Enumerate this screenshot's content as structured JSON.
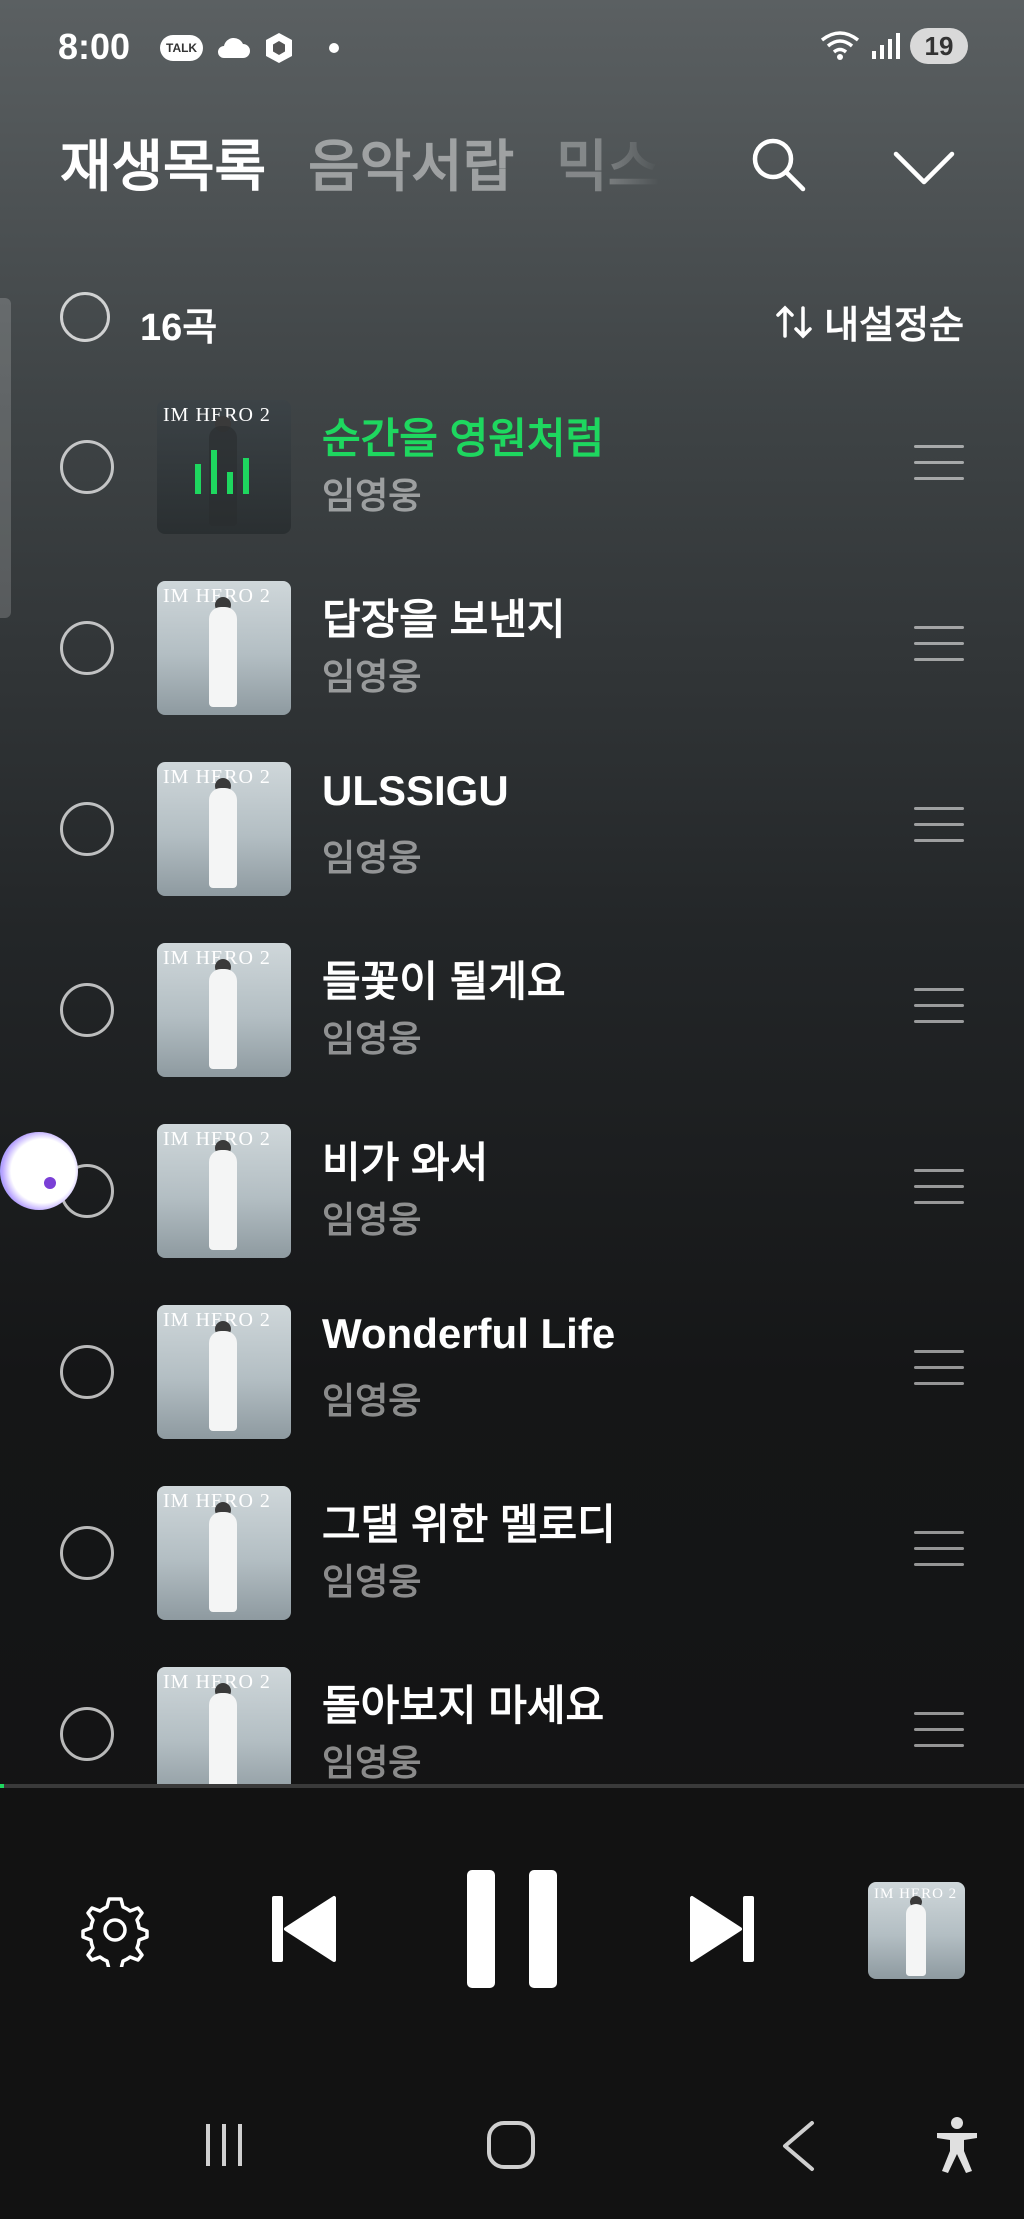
{
  "status_bar": {
    "time": "8:00",
    "talk_badge": "TALK",
    "battery": "19"
  },
  "header": {
    "tabs": [
      {
        "label": "재생목록",
        "active": true
      },
      {
        "label": "음악서랍",
        "active": false
      },
      {
        "label": "믹스",
        "active": false
      }
    ]
  },
  "list_header": {
    "count": "16곡",
    "sort_label": "내설정순"
  },
  "album_label": "IM HERO 2",
  "songs": [
    {
      "title": "순간을 영원처럼",
      "artist": "임영웅",
      "playing": true
    },
    {
      "title": "답장을 보낸지",
      "artist": "임영웅",
      "playing": false
    },
    {
      "title": "ULSSIGU",
      "artist": "임영웅",
      "playing": false
    },
    {
      "title": "들꽃이 될게요",
      "artist": "임영웅",
      "playing": false
    },
    {
      "title": "비가 와서",
      "artist": "임영웅",
      "playing": false
    },
    {
      "title": "Wonderful Life",
      "artist": "임영웅",
      "playing": false
    },
    {
      "title": "그댈 위한 멜로디",
      "artist": "임영웅",
      "playing": false
    },
    {
      "title": "돌아보지 마세요",
      "artist": "임영웅",
      "playing": false
    }
  ],
  "player": {
    "state": "playing",
    "icons": [
      "settings-icon",
      "previous-icon",
      "pause-icon",
      "next-icon"
    ]
  },
  "nav": {
    "icons": [
      "recents-icon",
      "home-icon",
      "back-icon",
      "accessibility-icon"
    ]
  },
  "colors": {
    "accent": "#1ed75f",
    "background": "#121212"
  }
}
